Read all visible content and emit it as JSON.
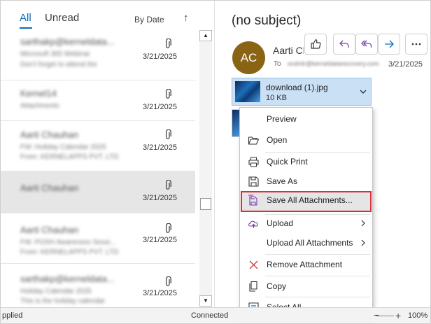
{
  "list": {
    "tabs": {
      "all": "All",
      "unread": "Unread"
    },
    "sort_label": "By Date",
    "sort_dir_icon": "↑",
    "items": [
      {
        "line1": "sarthakp@kerneldata...",
        "line2": "Microsoft 365 Webinar",
        "line3": "Don't forget to attend the",
        "date": "3/21/2025"
      },
      {
        "line1": "Kernel14",
        "line2": "Attachments",
        "line3": "",
        "date": "3/21/2025"
      },
      {
        "line1": "Aarti Chauhan",
        "line2": "FW: Holiday Calendar 2025",
        "line3": "From: KERNELAPPS PVT. LTD",
        "date": "3/21/2025"
      },
      {
        "line1": "Aarti Chauhan",
        "line2": "",
        "line3": "",
        "date": "3/21/2025"
      },
      {
        "line1": "Aarti Chauhan",
        "line2": "FW: POSH Awareness Sessi...",
        "line3": "From: KERNELAPPS PVT. LTD",
        "date": "3/21/2025"
      },
      {
        "line1": "sarthakp@kerneldata...",
        "line2": "Holiday Calendar 2025",
        "line3": "This is the holiday calendar",
        "date": "3/21/2025"
      }
    ]
  },
  "reading": {
    "subject": "(no subject)",
    "avatar_initials": "AC",
    "sender": "Aarti Chauhan",
    "to_label": "To",
    "to_value": "ondrdr@kerneldatarecovery.com",
    "date": "3/21/2025",
    "actions": [
      "like-icon",
      "reply-icon",
      "reply-all-icon",
      "forward-icon",
      "more-icon"
    ]
  },
  "attachment": {
    "name": "download (1).jpg",
    "size": "10 KB"
  },
  "menu": {
    "items": [
      {
        "label": "Preview",
        "icon": "preview-icon"
      },
      {
        "label": "Open",
        "icon": "open-folder-icon"
      },
      {
        "label": "Quick Print",
        "icon": "printer-icon"
      },
      {
        "label": "Save As",
        "icon": "save-as-icon"
      },
      {
        "label": "Save All Attachments...",
        "icon": "save-all-icon"
      },
      {
        "label": "Upload",
        "icon": "upload-icon"
      },
      {
        "label": "Upload All Attachments",
        "icon": ""
      },
      {
        "label": "Remove Attachment",
        "icon": "remove-icon"
      },
      {
        "label": "Copy",
        "icon": "copy-icon"
      },
      {
        "label": "Select All",
        "icon": "select-all-icon"
      }
    ]
  },
  "status": {
    "left": "pplied",
    "connection": "Connected",
    "minus": "−",
    "plus": "+",
    "zoom": "100%"
  },
  "colors": {
    "accent": "#0f6cbd",
    "avatar": "#8a6415",
    "attachment_bg": "#c9e0f5",
    "highlight_border": "#d9303d"
  }
}
